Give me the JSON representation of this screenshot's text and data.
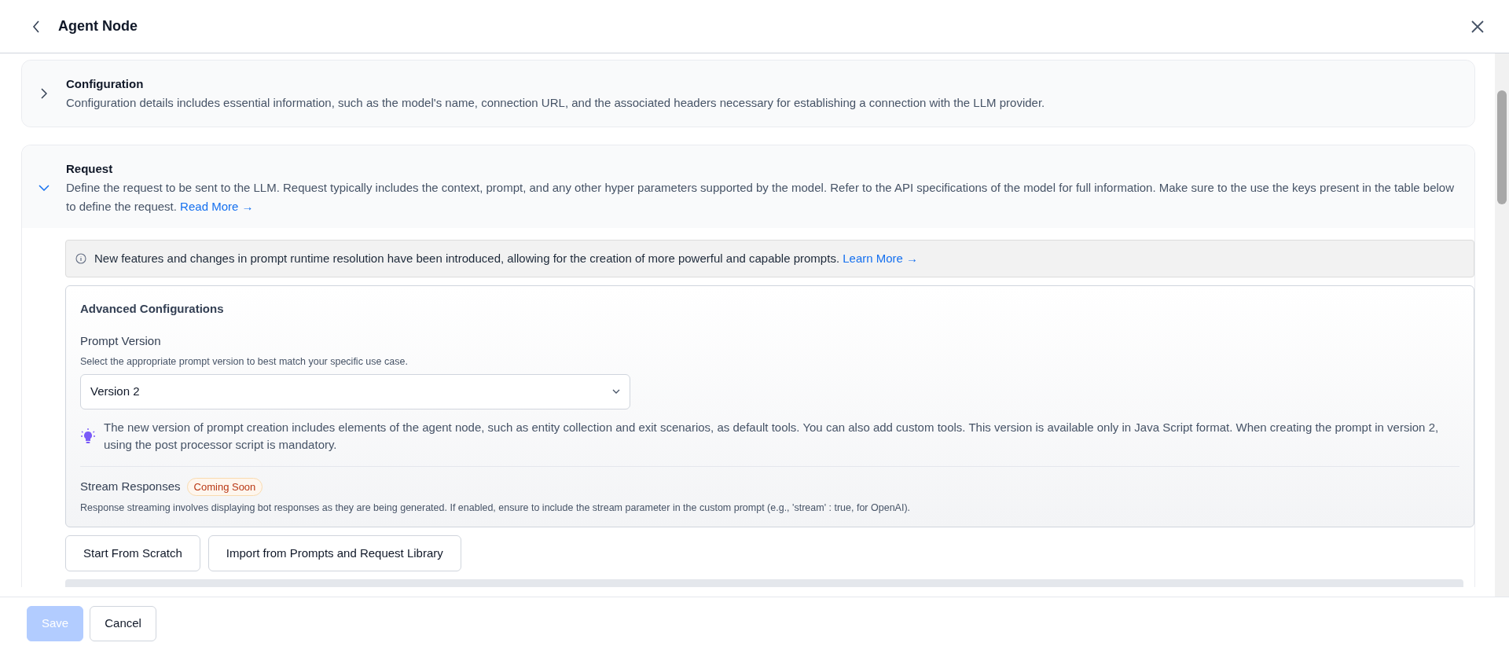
{
  "header": {
    "title": "Agent Node"
  },
  "sections": [
    {
      "title": "Configuration",
      "description": "Configuration details includes essential information, such as the model's name, connection URL, and the associated headers necessary for establishing a connection with the LLM provider.",
      "expanded": false
    },
    {
      "title": "Request",
      "description": "Define the request to be sent to the LLM. Request typically includes the context, prompt, and any other hyper parameters supported by the model. Refer to the API specifications of the model for full information. Make sure to the use the keys present in the table below to define the request.",
      "link": "Read More →",
      "expanded": true
    }
  ],
  "info_banner": {
    "text": "New features and changes in prompt runtime resolution have been introduced, allowing for the creation of more powerful and capable prompts.",
    "link": "Learn More →"
  },
  "advanced": {
    "title": "Advanced Configurations",
    "prompt_version": {
      "label": "Prompt Version",
      "hint": "Select the appropriate prompt version to best match your specific use case.",
      "value": "Version 2",
      "tip": "The new version of prompt creation includes elements of the agent node, such as entity collection and exit scenarios, as default tools. You can also add custom tools. This version is available only in Java Script format. When creating the prompt in version 2, using the post processor script is mandatory."
    },
    "stream": {
      "label": "Stream Responses",
      "badge": "Coming Soon",
      "description": "Response streaming involves displaying bot responses as they are being generated. If enabled, ensure to include the stream parameter in the custom prompt (e.g., 'stream' : true, for OpenAI)."
    }
  },
  "actions": [
    "Start From Scratch",
    "Import from Prompts and Request Library"
  ],
  "footer": {
    "buttons": [
      {
        "label": "Save",
        "disabled": true,
        "kind": "primary"
      },
      {
        "label": "Cancel",
        "disabled": false,
        "kind": "secondary"
      }
    ]
  }
}
